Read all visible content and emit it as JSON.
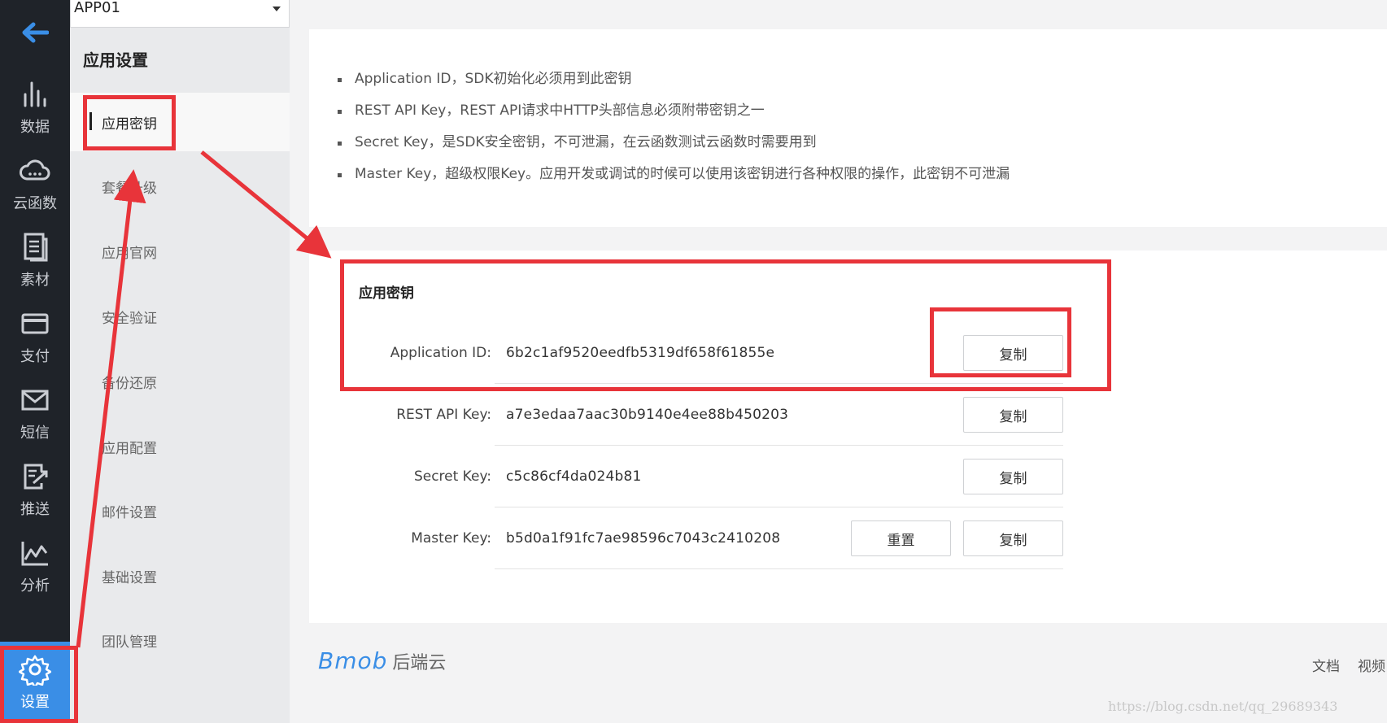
{
  "app_selector": {
    "value": "APP01"
  },
  "rail": {
    "items": [
      {
        "label": "数据",
        "icon": "bar-chart-icon"
      },
      {
        "label": "云函数",
        "icon": "cloud-icon"
      },
      {
        "label": "素材",
        "icon": "document-icon"
      },
      {
        "label": "支付",
        "icon": "card-icon"
      },
      {
        "label": "短信",
        "icon": "mail-icon"
      },
      {
        "label": "推送",
        "icon": "push-icon"
      },
      {
        "label": "分析",
        "icon": "line-chart-icon"
      },
      {
        "label": "设置",
        "icon": "gear-icon",
        "active": true
      }
    ]
  },
  "subnav": {
    "title": "应用设置",
    "items": [
      {
        "label": "应用密钥",
        "active": true
      },
      {
        "label": "套餐升级"
      },
      {
        "label": "应用官网"
      },
      {
        "label": "安全验证"
      },
      {
        "label": "备份还原"
      },
      {
        "label": "应用配置"
      },
      {
        "label": "邮件设置"
      },
      {
        "label": "基础设置"
      },
      {
        "label": "团队管理"
      }
    ]
  },
  "info": {
    "items": [
      "Application ID，SDK初始化必须用到此密钥",
      "REST API Key，REST API请求中HTTP头部信息必须附带密钥之一",
      "Secret Key，是SDK安全密钥，不可泄漏，在云函数测试云函数时需要用到",
      "Master Key，超级权限Key。应用开发或调试的时候可以使用该密钥进行各种权限的操作，此密钥不可泄漏"
    ]
  },
  "keys": {
    "title": "应用密钥",
    "copy_label": "复制",
    "reset_label": "重置",
    "rows": [
      {
        "label": "Application ID:",
        "value": "6b2c1af9520eedfb5319df658f61855e"
      },
      {
        "label": "REST API Key:",
        "value": "a7e3edaa7aac30b9140e4ee88b450203"
      },
      {
        "label": "Secret Key:",
        "value": "c5c86cf4da024b81"
      },
      {
        "label": "Master Key:",
        "value": "b5d0a1f91fc7ae98596c7043c2410208"
      }
    ]
  },
  "footer": {
    "brand": "Bmob",
    "brand_sub": "后端云",
    "links": [
      "文档",
      "视频"
    ]
  },
  "watermark": "https://blog.csdn.net/qq_29689343",
  "colors": {
    "highlight": "#e8343a",
    "accent": "#3a8ee6",
    "rail_bg": "#1f2329"
  }
}
